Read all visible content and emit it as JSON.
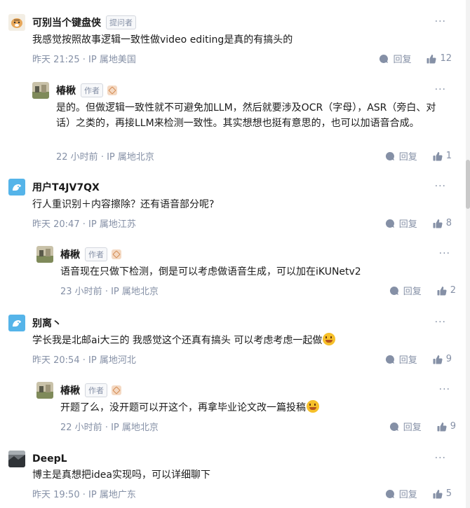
{
  "labels": {
    "reply": "回复",
    "more": "···"
  },
  "colors": {
    "accent": "#8590a6",
    "text": "#1a1a1a",
    "badge": "#f4d9c3"
  },
  "comments": [
    {
      "author": "可别当个键盘侠",
      "tag": "提问者",
      "avatar_icon": "tiger-avatar",
      "text": "我感觉按照故事逻辑一致性做video editing是真的有搞头的",
      "time": "昨天 21:25",
      "location": "IP 属地美国",
      "likes": "12",
      "reply": {
        "author": "椿楸",
        "tag": "作者",
        "text": "是的。但做逻辑一致性就不可避免加LLM，然后就要涉及OCR（字母），ASR（旁白、对话）之类的，再接LLM来检测一致性。其实想想也挺有意思的，也可以加语音合成。",
        "time": "22 小时前",
        "location": "IP 属地北京",
        "likes": "1"
      }
    },
    {
      "author": "用户T4JV7QX",
      "avatar_icon": "default-bird-avatar",
      "text": "行人重识别＋内容擦除？还有语音部分呢?",
      "time": "昨天 20:47",
      "location": "IP 属地江苏",
      "likes": "8",
      "reply": {
        "author": "椿楸",
        "tag": "作者",
        "text": "语音现在只做下检测，倒是可以考虑做语音生成，可以加在iKUNetv2",
        "time": "23 小时前",
        "location": "IP 属地北京",
        "likes": "2"
      }
    },
    {
      "author": "别离丶",
      "avatar_icon": "default-bird-avatar",
      "text": "学长我是北邮ai大三的 我感觉这个还真有搞头 可以考虑考虑一起做",
      "emoji": "rofl-emoji",
      "time": "昨天 20:54",
      "location": "IP 属地河北",
      "likes": "9",
      "reply": {
        "author": "椿楸",
        "tag": "作者",
        "text": "开题了么，没开题可以开这个，再拿毕业论文改一篇投稿",
        "emoji": "grin-sweat-emoji",
        "time": "22 小时前",
        "location": "IP 属地北京",
        "likes": "9"
      }
    },
    {
      "author": "DeepL",
      "avatar_icon": "landscape-avatar",
      "text": "博主是真想把idea实现吗，可以详细聊下",
      "time": "昨天 19:50",
      "location": "IP 属地广东",
      "likes": "5"
    }
  ]
}
